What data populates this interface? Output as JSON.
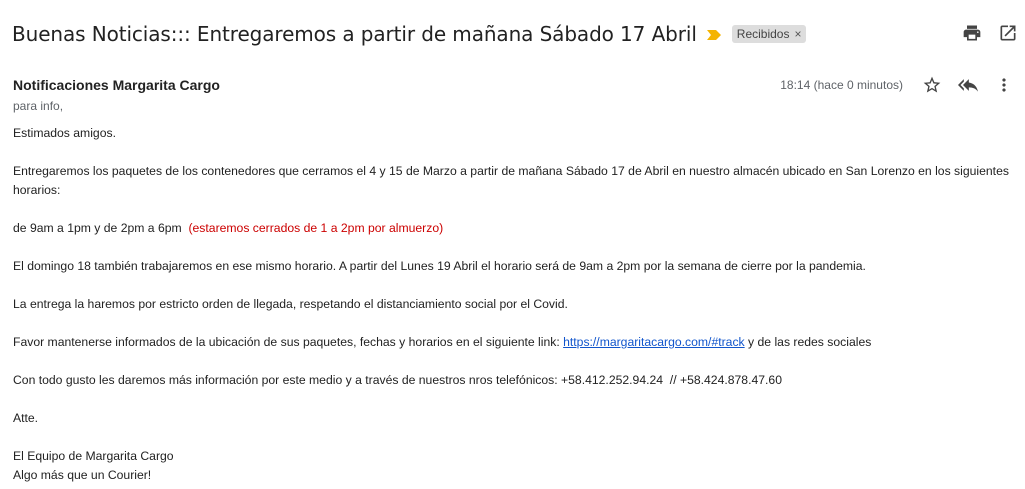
{
  "subject": {
    "title": "Buenas Noticias::: Entregaremos a partir de mañana Sábado 17 Abril",
    "label": "Recibidos",
    "label_remove": "×"
  },
  "icons": {
    "importance": "importance-marker-icon",
    "print": "print-icon",
    "open_new_window": "open-in-new-window-icon",
    "star": "star-icon",
    "reply": "reply-all-icon",
    "more": "more-vert-icon"
  },
  "colors": {
    "importance": "#f4b400",
    "red_text": "#cc0000",
    "link": "#1155cc"
  },
  "message": {
    "sender": "Notificaciones Margarita Cargo",
    "recipient": "para info,",
    "timestamp": "18:14 (hace 0 minutos)"
  },
  "body": {
    "greeting": "Estimados amigos.",
    "p1": "Entregaremos los paquetes de los contenedores que cerramos el 4 y 15 de Marzo a partir de mañana Sábado 17 de Abril en nuestro almacén ubicado en San Lorenzo en los siguientes horarios:",
    "hours": "de 9am a 1pm y de 2pm a 6pm",
    "hours_note": "(estaremos cerrados de 1 a 2pm por almuerzo)",
    "p2": "El domingo 18 también trabajaremos en ese mismo horario. A partir del Lunes 19 Abril el horario será de 9am a 2pm por la semana de cierre por la pandemia.",
    "p3": "La entrega la haremos por estricto orden de llegada, respetando el distanciamiento social por el Covid.",
    "p4_before": "Favor mantenerse informados de la ubicación de sus paquetes, fechas y horarios en el siguiente link:",
    "p4_link": "https://margaritacargo.com/#track",
    "p4_after": "y de las redes sociales",
    "p5": "Con todo gusto les daremos más información por este medio y a través de nuestros nros telefónicos: +58.412.252.94.24  // +58.424.878.47.60",
    "closing": "Atte.",
    "signature_1": "El Equipo de Margarita Cargo",
    "signature_2": "Algo más que un Courier!"
  }
}
